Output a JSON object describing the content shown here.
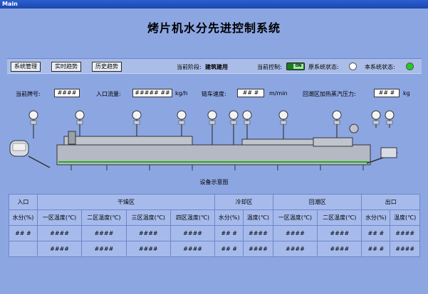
{
  "window": {
    "title": "Main"
  },
  "header": {
    "title": "烤片机水分先进控制系统"
  },
  "toolbar": {
    "buttons": [
      "系统管理",
      "实时趋势",
      "历史趋势"
    ],
    "stage_label": "当前阶段:",
    "stage_value": "建筑建用",
    "control_label": "当前控制:",
    "toggle_text": "ON",
    "orig_status_label": "原系统状态:",
    "this_status_label": "本系统状态:"
  },
  "params": {
    "brand_label": "当前牌号:",
    "brand_value": "####",
    "flow_label": "入口流量:",
    "flow_value": "##### ##",
    "flow_unit": "kg/h",
    "chain_label": "链车速度:",
    "chain_value": "## #",
    "chain_unit": "m/min",
    "steam_label": "回潮区加热蒸汽压力:",
    "steam_value": "## #",
    "steam_unit": "kg"
  },
  "diagram": {
    "caption": "设备示意图"
  },
  "table": {
    "groups": [
      "入口",
      "干燥区",
      "冷却区",
      "回潮区",
      "出口"
    ],
    "subheaders": [
      "水分(%)",
      "一区温度(℃)",
      "二区温度(℃)",
      "三区温度(℃)",
      "四区温度(℃)",
      "水分(%)",
      "温度(℃)",
      "一区温度(℃)",
      "二区温度(℃)",
      "水分(%)",
      "温度(℃)"
    ],
    "row1": [
      "## #",
      "####",
      "####",
      "####",
      "####",
      "## #",
      "####",
      "####",
      "####",
      "## #",
      "####"
    ],
    "row2": [
      "",
      "####",
      "####",
      "####",
      "####",
      "## #",
      "####",
      "####",
      "####",
      "## #",
      "####"
    ]
  },
  "colors": {
    "background": "#8ca6e2",
    "status_orig": "#ffffff",
    "status_this": "#22cc22",
    "toggle": "#1e7a1e"
  }
}
